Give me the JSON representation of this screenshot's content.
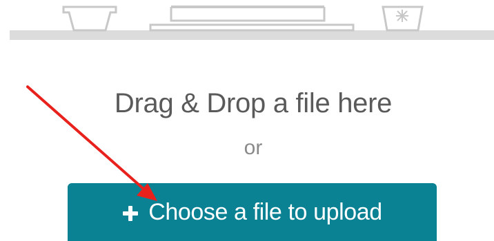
{
  "uploader": {
    "drop_text": "Drag & Drop a file here",
    "or_text": "or",
    "button_label": "Choose a file to upload",
    "button_icon": "plus-icon",
    "button_color": "#0b8294"
  },
  "illustration": {
    "icons": [
      "plant-pot-icon",
      "laptop-icon",
      "trash-bin-icon"
    ],
    "stroke_color": "#cfcfcf"
  },
  "annotation": {
    "icon": "red-arrow-icon",
    "color": "#e8211d"
  }
}
